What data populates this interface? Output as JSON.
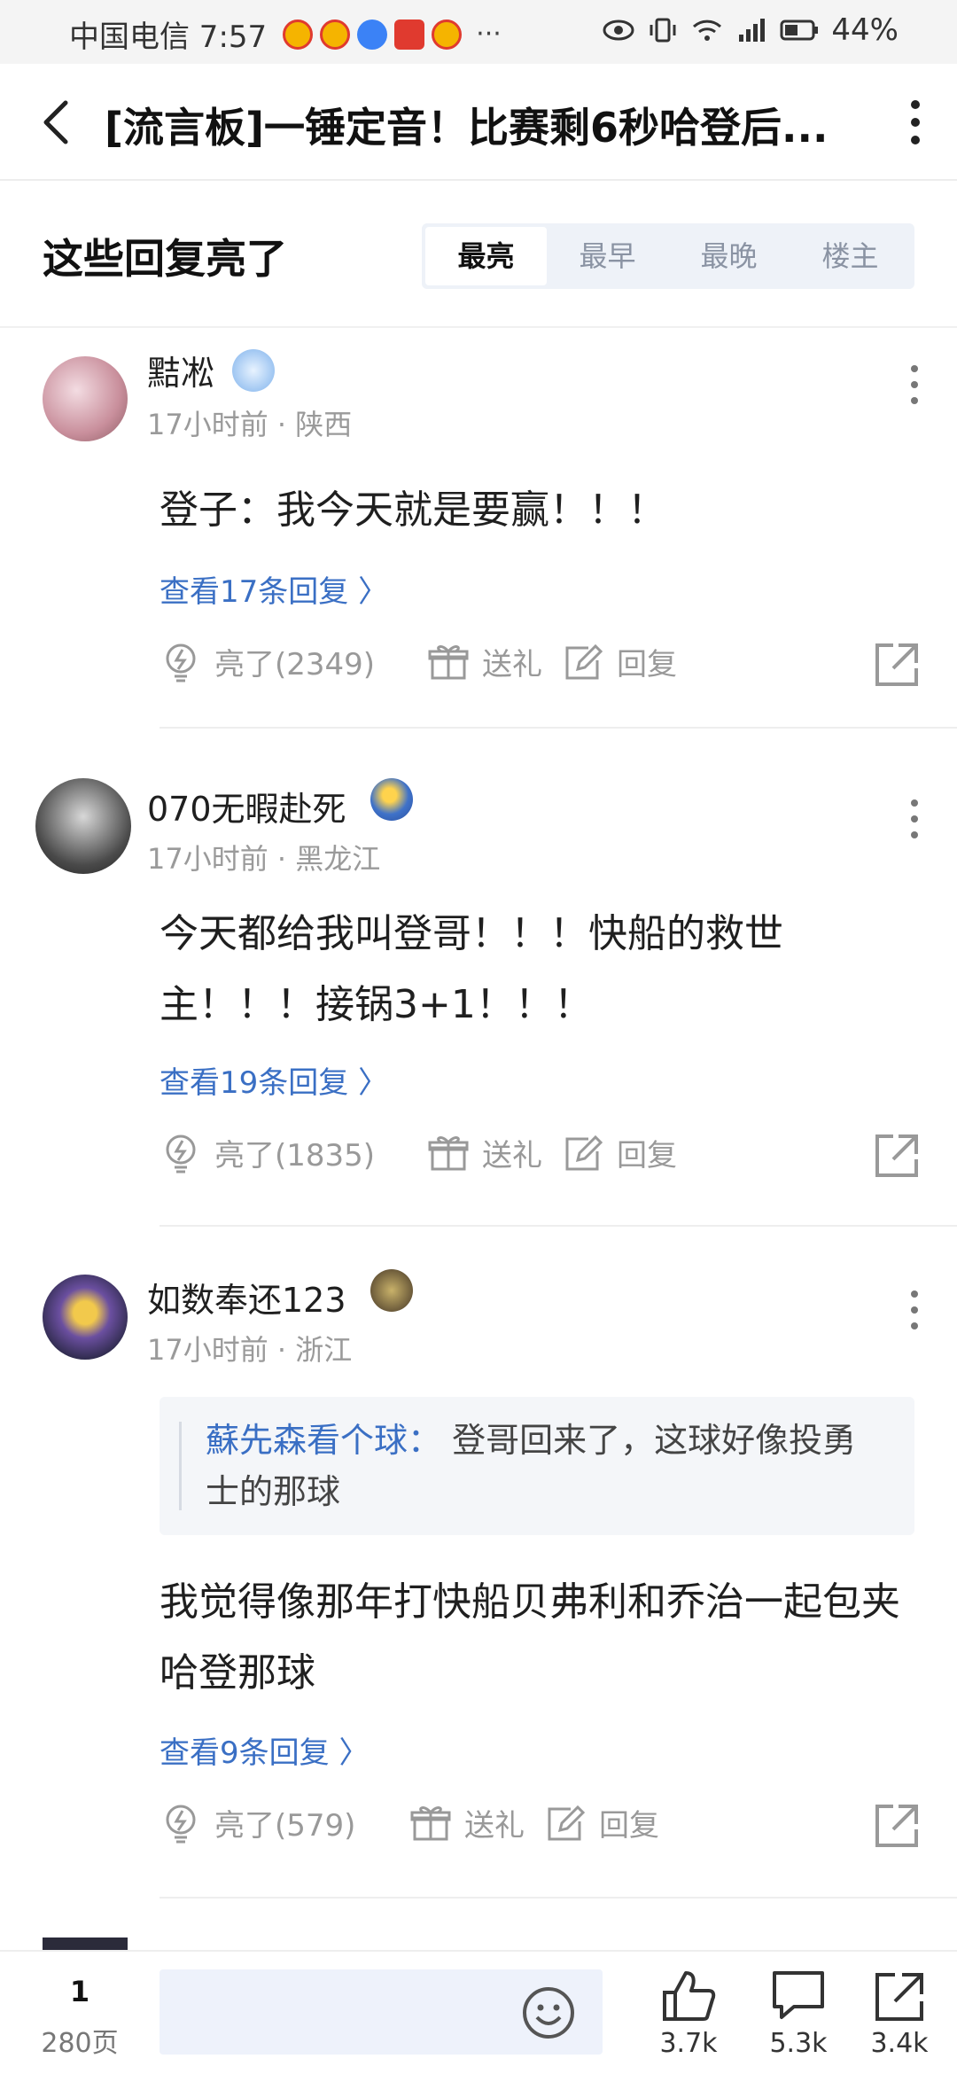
{
  "status_bar": {
    "carrier_time": "中国电信 7:57",
    "more": "···",
    "battery": "44%"
  },
  "header": {
    "title": "[流言板]一锤定音！比赛剩6秒哈登后..."
  },
  "section": {
    "title": "这些回复亮了",
    "tabs": [
      "最亮",
      "最早",
      "最晚",
      "楼主"
    ],
    "active_tab": "最亮"
  },
  "comments": [
    {
      "username": "黠凇",
      "meta": "17小时前 · 陕西",
      "text": "登子：我今天就是要赢！！！",
      "replies": "查看17条回复 〉",
      "likes": "亮了(2349)",
      "gift": "送礼",
      "reply": "回复"
    },
    {
      "username": "070无暇赴死",
      "meta": "17小时前 · 黑龙江",
      "text": "今天都给我叫登哥！！！快船的救世主！！！接锅3+1！！！",
      "replies": "查看19条回复 〉",
      "likes": "亮了(1835)",
      "gift": "送礼",
      "reply": "回复"
    },
    {
      "username": "如数奉还123",
      "meta": "17小时前 · 浙江",
      "quote_user": "蘇先森看个球：",
      "quote_text": "登哥回来了，这球好像投勇士的那球",
      "text": "我觉得像那年打快船贝弗利和乔治一起包夹哈登那球",
      "replies": "查看9条回复 〉",
      "likes": "亮了(579)",
      "gift": "送礼",
      "reply": "回复"
    }
  ],
  "bottom_bar": {
    "page": "1",
    "total_pages": "280页",
    "likes": "3.7k",
    "comments": "5.3k",
    "shares": "3.4k"
  },
  "colors": {
    "accent_blue": "#3a6fc4",
    "meta_gray": "#9a9a9a",
    "tab_bg": "#eef2f8"
  }
}
